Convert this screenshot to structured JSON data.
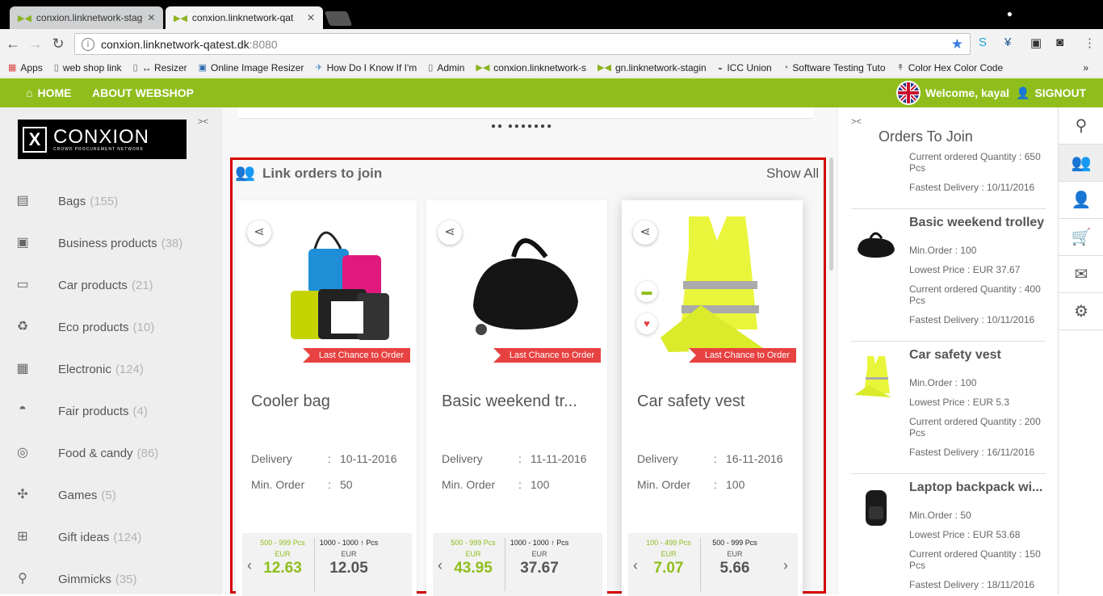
{
  "browser": {
    "tabs": [
      {
        "title": "conxion.linknetwork-stag",
        "active": false
      },
      {
        "title": "conxion.linknetwork-qat",
        "active": true
      }
    ],
    "url_host": "conxion.linknetwork-qatest.dk",
    "url_port": ":8080",
    "bookmarks": [
      {
        "label": "Apps",
        "icon": "apps-grid-icon"
      },
      {
        "label": "web shop link",
        "icon": "folder-icon"
      },
      {
        "label": "↔ Resizer",
        "icon": "page-icon"
      },
      {
        "label": "Online Image Resizer",
        "icon": "image-icon"
      },
      {
        "label": "How Do I Know If I'm",
        "icon": "bird-icon"
      },
      {
        "label": "Admin",
        "icon": "page-icon"
      },
      {
        "label": "conxion.linknetwork-s",
        "icon": "conxion-icon"
      },
      {
        "label": "gn.linknetwork-stagin",
        "icon": "conxion-icon"
      },
      {
        "label": "ICC Union",
        "icon": "icc-icon"
      },
      {
        "label": "Software Testing Tuto",
        "icon": "tutorial-icon"
      },
      {
        "label": "Color Hex Color Code",
        "icon": "pin-icon"
      }
    ],
    "bookmarks_more": "»"
  },
  "header": {
    "home": "HOME",
    "about": "ABOUT WEBSHOP",
    "welcome": "Welcome, kayal",
    "signout": "SIGNOUT"
  },
  "logo": {
    "name": "CONXION",
    "tagline": "CROWD PROCUREMENT NETWORK"
  },
  "categories": [
    {
      "label": "Bags",
      "count": "(155)",
      "icon": "bag-icon"
    },
    {
      "label": "Business products",
      "count": "(38)",
      "icon": "briefcase-icon"
    },
    {
      "label": "Car products",
      "count": "(21)",
      "icon": "car-icon"
    },
    {
      "label": "Eco products",
      "count": "(10)",
      "icon": "recycle-icon"
    },
    {
      "label": "Electronic",
      "count": "(124)",
      "icon": "chip-icon"
    },
    {
      "label": "Fair products",
      "count": "(4)",
      "icon": "basket-icon"
    },
    {
      "label": "Food & candy",
      "count": "(86)",
      "icon": "candy-icon"
    },
    {
      "label": "Games",
      "count": "(5)",
      "icon": "games-icon"
    },
    {
      "label": "Gift ideas",
      "count": "(124)",
      "icon": "gift-icon"
    },
    {
      "label": "Gimmicks",
      "count": "(35)",
      "icon": "wand-icon"
    }
  ],
  "main": {
    "section_title": "Link orders to join",
    "show_all": "Show All",
    "carousel_dots": "●● ●●●●●●●",
    "cards": [
      {
        "title": "Cooler bag",
        "ribbon": "Last Chance to Order",
        "delivery_label": "Delivery",
        "delivery": "10-11-2016",
        "min_label": "Min. Order",
        "min_order": "50",
        "prices": [
          {
            "range": "500 - 999 Pcs",
            "currency": "EUR",
            "value": "12.63",
            "highlight": true
          },
          {
            "range": "1000 - 1000 ↑ Pcs",
            "currency": "EUR",
            "value": "12.05",
            "highlight": false
          }
        ]
      },
      {
        "title": "Basic weekend tr...",
        "ribbon": "Last Chance to Order",
        "delivery_label": "Delivery",
        "delivery": "11-11-2016",
        "min_label": "Min. Order",
        "min_order": "100",
        "prices": [
          {
            "range": "500 - 999 Pcs",
            "currency": "EUR",
            "value": "43.95",
            "highlight": true
          },
          {
            "range": "1000 - 1000 ↑ Pcs",
            "currency": "EUR",
            "value": "37.67",
            "highlight": false
          }
        ]
      },
      {
        "title": "Car safety vest",
        "ribbon": "Last Chance to Order",
        "delivery_label": "Delivery",
        "delivery": "16-11-2016",
        "min_label": "Min. Order",
        "min_order": "100",
        "prices": [
          {
            "range": "100 - 499 Pcs",
            "currency": "EUR",
            "value": "7.07",
            "highlight": true
          },
          {
            "range": "500 - 999 Pcs",
            "currency": "EUR",
            "value": "5.66",
            "highlight": false
          }
        ]
      }
    ]
  },
  "orders_panel": {
    "title": "Orders To Join",
    "partial_top": {
      "qty": "Current ordered Quantity : 650 Pcs",
      "delivery": "Fastest Delivery : 10/11/2016"
    },
    "items": [
      {
        "name": "Basic weekend trolley",
        "min": "Min.Order : 100",
        "price": "Lowest Price : EUR 37.67",
        "qty": "Current ordered Quantity : 400 Pcs",
        "delivery": "Fastest Delivery : 10/11/2016"
      },
      {
        "name": "Car safety vest",
        "min": "Min.Order : 100",
        "price": "Lowest Price : EUR 5.3",
        "qty": "Current ordered Quantity : 200 Pcs",
        "delivery": "Fastest Delivery : 16/11/2016"
      },
      {
        "name": "Laptop backpack wi...",
        "min": "Min.Order : 50",
        "price": "Lowest Price : EUR 53.68",
        "qty": "Current ordered Quantity : 150 Pcs",
        "delivery": "Fastest Delivery : 18/11/2016"
      }
    ]
  },
  "icon_column": [
    "search-icon",
    "group-icon",
    "user-icon",
    "cart-icon",
    "mail-icon",
    "settings-icon"
  ],
  "colors": {
    "brand_green": "#8fbe1c",
    "ribbon_red": "#e84141",
    "highlight_red": "#d40000"
  }
}
